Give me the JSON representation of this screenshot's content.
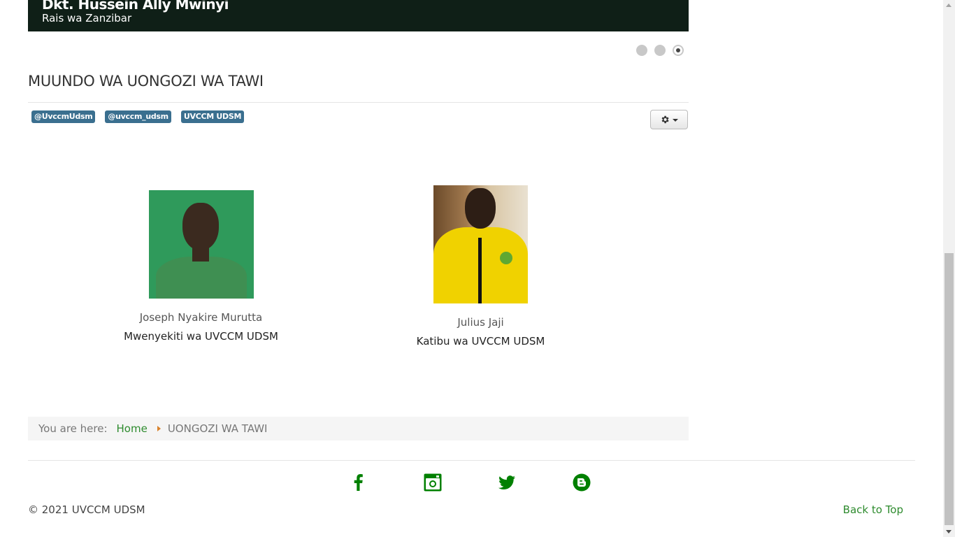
{
  "slider": {
    "person_name": "Dkt. Hussein Ally Mwinyi",
    "person_title": "Rais wa Zanzibar",
    "dots": [
      {
        "label": "slide-1",
        "active": false
      },
      {
        "label": "slide-2",
        "active": false
      },
      {
        "label": "slide-3",
        "active": true
      }
    ]
  },
  "article": {
    "title": "MUUNDO WA UONGOZI WA TAWI",
    "tags": [
      "@UvccmUdsm",
      "@uvccm_udsm",
      "UVCCM UDSM"
    ],
    "tools_icon": "gear-icon"
  },
  "members": [
    {
      "name": "Joseph Nyakire Murutta",
      "role": "Mwenyekiti wa UVCCM UDSM"
    },
    {
      "name": "Julius Jaji",
      "role": "Katibu wa UVCCM UDSM"
    }
  ],
  "breadcrumb": {
    "prefix": "You are here:",
    "home": "Home",
    "current": "UONGOZI WA TAWI"
  },
  "footer": {
    "social": [
      "facebook-icon",
      "instagram-icon",
      "twitter-icon",
      "blogger-icon"
    ],
    "copyright": "© 2021 UVCCM UDSM",
    "back_to_top": "Back to Top"
  },
  "colors": {
    "accent_green": "#008000",
    "tag_blue": "#3a6f8f",
    "slider_bg": "#0f1f17"
  }
}
